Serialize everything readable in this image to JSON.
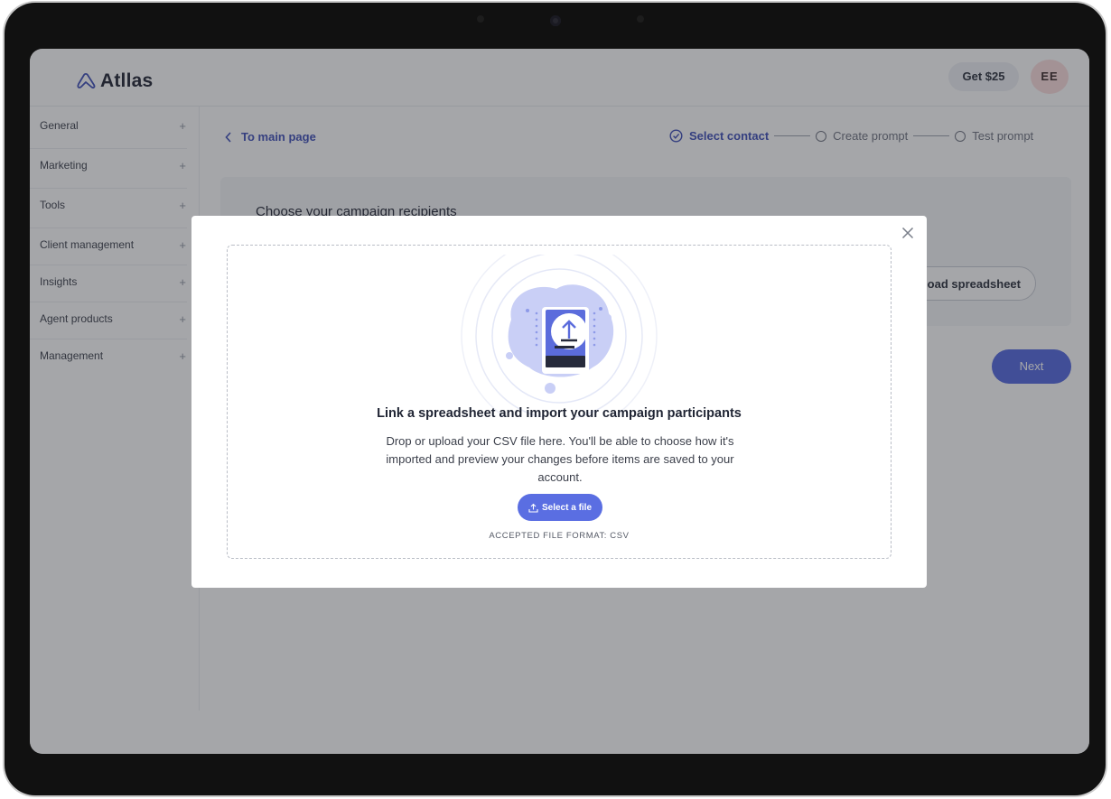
{
  "header": {
    "logo_text": "Atllas",
    "get_button": "Get $25",
    "avatar_initials": "EE"
  },
  "sidebar": {
    "items": [
      {
        "label": "General"
      },
      {
        "label": "Marketing"
      },
      {
        "label": "Tools"
      },
      {
        "label": "Client management"
      },
      {
        "label": "Insights"
      },
      {
        "label": "Agent products"
      },
      {
        "label": "Management"
      }
    ],
    "expand_symbol": "+"
  },
  "nav": {
    "back_label": "To main page",
    "back_icon": "chevron-left-icon"
  },
  "stepper": {
    "steps": [
      {
        "label": "Select contact",
        "state": "active"
      },
      {
        "label": "Create prompt",
        "state": "pending"
      },
      {
        "label": "Test prompt",
        "state": "pending"
      }
    ]
  },
  "card": {
    "title": "Choose your campaign recipients",
    "upload_button": "Upload spreadsheet",
    "upload_button_visible": "oad spreadsheet"
  },
  "next_button": "Next",
  "modal": {
    "title": "Link a spreadsheet and import your campaign participants",
    "description": "Drop or upload your CSV file here. You'll be able to choose how it's imported and preview your changes before items are saved to your account.",
    "select_button": "Select a file",
    "accepted_formats": "ACCEPTED FILE FORMAT: CSV",
    "close_icon": "close-icon",
    "illustration": "upload-document-illustration"
  },
  "colors": {
    "accent": "#5468e0",
    "link": "#3e4fb8",
    "avatar_bg": "#fbdddd",
    "overlay": "rgba(40,42,50,0.42)"
  }
}
